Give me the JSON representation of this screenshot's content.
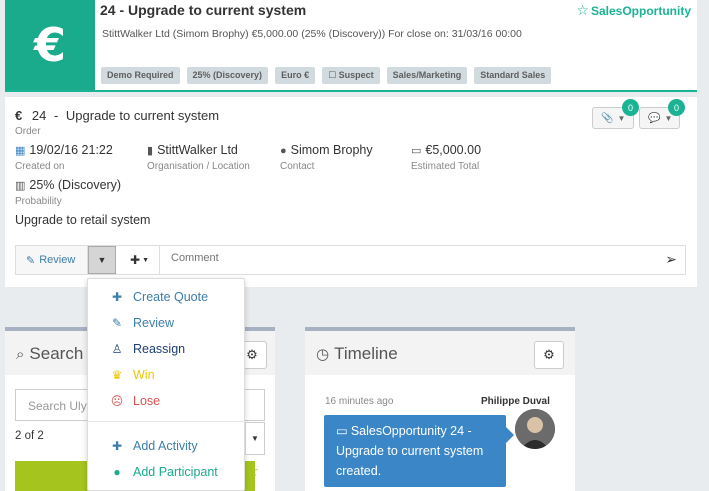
{
  "header": {
    "currency_symbol": "€",
    "title": "24 - Upgrade to current system",
    "type_label": "SalesOpportunity",
    "subtitle": "StittWalker Ltd (Simom Brophy) €5,000.00 (25% (Discovery)) For close on: 31/03/16 00:00",
    "tags": [
      "Demo Required",
      "25% (Discovery)",
      "Euro €",
      "☐ Suspect",
      "Sales/Marketing",
      "Standard Sales"
    ]
  },
  "detail": {
    "currency_icon": "€",
    "number": "24",
    "separator": "-",
    "name": "Upgrade to current system",
    "kind": "Order",
    "created": "19/02/16 21:22",
    "created_label": "Created on",
    "organisation": "StittWalker Ltd",
    "organisation_label": "Organisation / Location",
    "contact": "Simom Brophy",
    "contact_label": "Contact",
    "total": "€5,000.00",
    "total_label": "Estimated Total",
    "probability": "25% (Discovery)",
    "probability_label": "Probability",
    "description": "Upgrade to retail system",
    "attachments_count": "0",
    "comments_count": "0"
  },
  "toolbar": {
    "review_label": "Review",
    "comment_placeholder": "Comment"
  },
  "search_panel": {
    "title": "Search",
    "input_placeholder": "Search Uly",
    "count": "2 of 2"
  },
  "timeline_panel": {
    "title": "Timeline",
    "time": "16 minutes ago",
    "author": "Philippe Duval",
    "message": "SalesOpportunity 24 - Upgrade to current system created."
  },
  "dropdown": {
    "items": [
      {
        "label": "Create Quote",
        "icon": "plus-icon",
        "color": "#3d7eaa"
      },
      {
        "label": "Review",
        "icon": "edit-icon",
        "color": "#3d7eaa"
      },
      {
        "label": "Reassign",
        "icon": "person-icon",
        "color": "#1c3f77"
      },
      {
        "label": "Win",
        "icon": "trophy-icon",
        "color": "#f0c400"
      },
      {
        "label": "Lose",
        "icon": "frown-icon",
        "color": "#d9534f"
      },
      {
        "label": "Add Activity",
        "icon": "plus-icon",
        "color": "#3d7eaa"
      },
      {
        "label": "Add Participant",
        "icon": "user-icon",
        "color": "#1aaa8c"
      }
    ]
  },
  "colors": {
    "accent": "#1ab394",
    "primary": "#3b86c6",
    "lime": "#a5c51e"
  }
}
